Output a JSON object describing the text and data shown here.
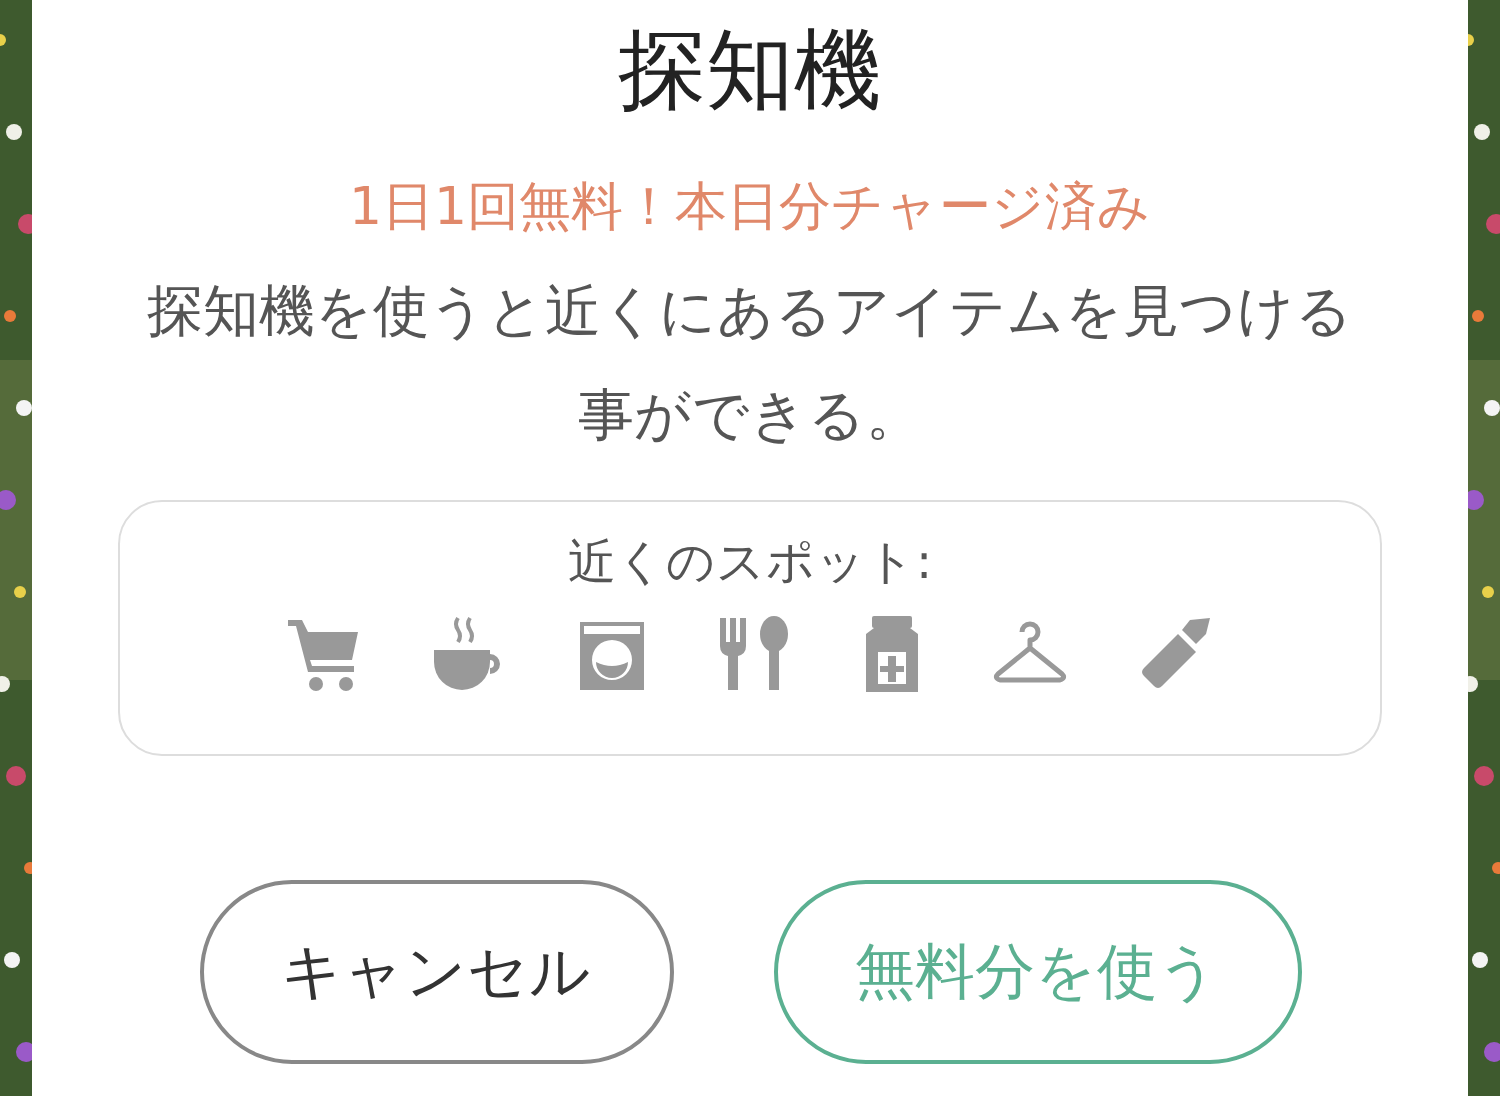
{
  "dialog": {
    "title": "探知機",
    "notice": "1日1回無料！本日分チャージ済み",
    "description": "探知機を使うと近くにあるアイテムを見つける事ができる。"
  },
  "spots": {
    "label": "近くのスポット:"
  },
  "buttons": [
    {
      "label": "キャンセル",
      "kind": "cancel"
    },
    {
      "label": "無料分を使う",
      "kind": "primary"
    }
  ]
}
